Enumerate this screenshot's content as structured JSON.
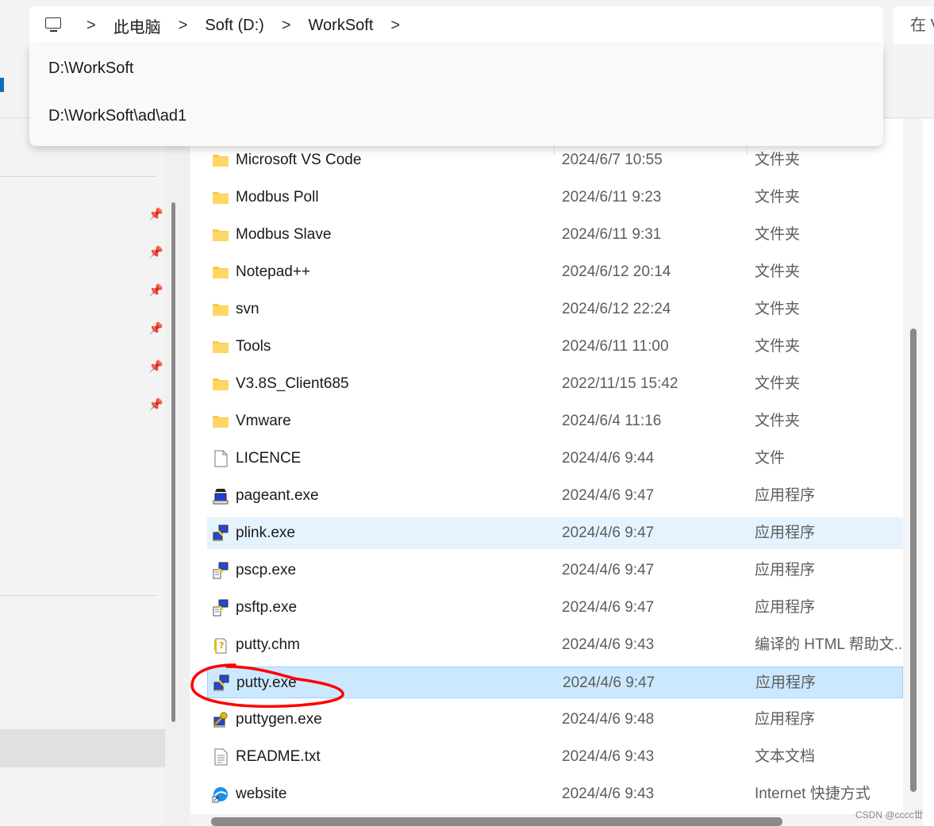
{
  "address_bar": {
    "icon": "this-pc-icon",
    "crumbs": [
      "此电脑",
      "Soft (D:)",
      "WorkSoft"
    ],
    "separator": ">"
  },
  "search": {
    "partial_text": "在 V"
  },
  "dropdown": {
    "items": [
      "D:\\WorkSoft",
      "D:\\WorkSoft\\ad\\ad1"
    ]
  },
  "files": [
    {
      "name": "Microsoft VS Code",
      "date": "2024/6/7 10:55",
      "type": "文件夹",
      "icon": "folder-icon"
    },
    {
      "name": "Modbus Poll",
      "date": "2024/6/11 9:23",
      "type": "文件夹",
      "icon": "folder-icon"
    },
    {
      "name": "Modbus Slave",
      "date": "2024/6/11 9:31",
      "type": "文件夹",
      "icon": "folder-icon"
    },
    {
      "name": "Notepad++",
      "date": "2024/6/12 20:14",
      "type": "文件夹",
      "icon": "folder-icon"
    },
    {
      "name": "svn",
      "date": "2024/6/12 22:24",
      "type": "文件夹",
      "icon": "folder-icon"
    },
    {
      "name": "Tools",
      "date": "2024/6/11 11:00",
      "type": "文件夹",
      "icon": "folder-icon"
    },
    {
      "name": "V3.8S_Client685",
      "date": "2022/11/15 15:42",
      "type": "文件夹",
      "icon": "folder-icon"
    },
    {
      "name": "Vmware",
      "date": "2024/6/4 11:16",
      "type": "文件夹",
      "icon": "folder-icon"
    },
    {
      "name": "LICENCE",
      "date": "2024/4/6 9:44",
      "type": "文件",
      "icon": "file-icon"
    },
    {
      "name": "pageant.exe",
      "date": "2024/4/6 9:47",
      "type": "应用程序",
      "icon": "pageant-icon"
    },
    {
      "name": "plink.exe",
      "date": "2024/4/6 9:47",
      "type": "应用程序",
      "icon": "putty-icon",
      "state": "hover"
    },
    {
      "name": "pscp.exe",
      "date": "2024/4/6 9:47",
      "type": "应用程序",
      "icon": "pscp-icon"
    },
    {
      "name": "psftp.exe",
      "date": "2024/4/6 9:47",
      "type": "应用程序",
      "icon": "pscp-icon"
    },
    {
      "name": "putty.chm",
      "date": "2024/4/6 9:43",
      "type": "编译的 HTML 帮助文...",
      "icon": "chm-help-icon"
    },
    {
      "name": "putty.exe",
      "date": "2024/4/6 9:47",
      "type": "应用程序",
      "icon": "putty-icon",
      "state": "selected"
    },
    {
      "name": "puttygen.exe",
      "date": "2024/4/6 9:48",
      "type": "应用程序",
      "icon": "puttygen-icon"
    },
    {
      "name": "README.txt",
      "date": "2024/4/6 9:43",
      "type": "文本文档",
      "icon": "text-document-icon"
    },
    {
      "name": "website",
      "date": "2024/4/6 9:43",
      "type": "Internet 快捷方式",
      "icon": "internet-shortcut-icon"
    }
  ],
  "watermark": "CSDN @cccc丗",
  "colors": {
    "accent": "#0f6cbd",
    "selected_row": "#cce8ff",
    "hover_row": "#e5f3ff",
    "annotation": "#ff0000",
    "folder": "#f8c94b"
  }
}
